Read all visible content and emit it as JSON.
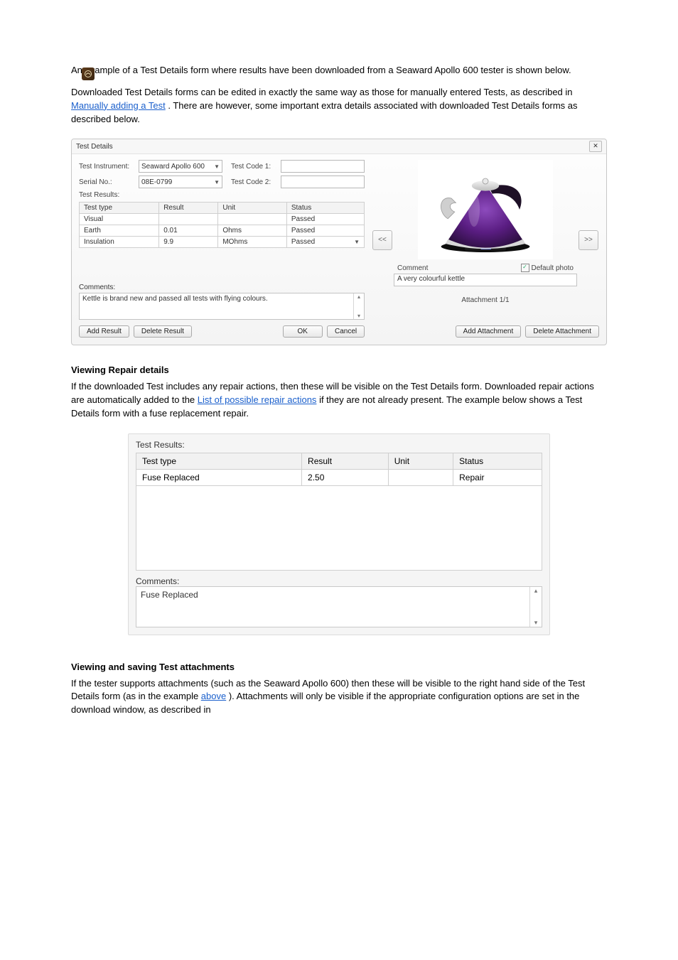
{
  "doc": {
    "paragraphs": {
      "p1": "An example of a Test Details form where results have been downloaded from a Seaward Apollo 600 tester is shown below.",
      "p2_prefix": "Downloaded Test Details forms can be edited in exactly the same way as those for manually entered Tests, as described in ",
      "p2_link": "Manually adding a Test",
      "p2_suffix": ". There are however, some important extra details associated with downloaded Test Details forms as described below.",
      "repairs_title": "Viewing Repair details",
      "repairs_p_prefix": "If the downloaded Test includes any repair actions, then these will be visible on the Test Details form. Downloaded repair actions are automatically added to the ",
      "repairs_link": "List of possible repair actions",
      "repairs_p_suffix": " if they are not already present. The example below shows a Test Details form with a fuse replacement repair.",
      "attach_title": "Viewing and saving Test attachments",
      "attach_p_prefix": "If the tester supports attachments (such as the Seaward Apollo 600) then these will be visible to the right hand side of the Test Details form (as in the example ",
      "attach_link_above": "above",
      "attach_p_suffix": "). Attachments will only be visible if the appropriate configuration options are set in the download window, as described in "
    }
  },
  "dialog": {
    "title": "Test Details",
    "labels": {
      "instrument": "Test Instrument:",
      "serial": "Serial No.:",
      "results": "Test Results:",
      "tc1": "Test Code 1:",
      "tc2": "Test Code 2:",
      "comments": "Comments:",
      "comment_r": "Comment",
      "default_photo": "Default photo",
      "att_count": "Attachment 1/1"
    },
    "values": {
      "instrument": "Seaward Apollo 600",
      "serial": "08E-0799",
      "tc1": "",
      "tc2": "",
      "comments": "Kettle is brand new and passed all tests with flying colours.",
      "att_comment": "A very colourful kettle"
    },
    "table": {
      "headers": [
        "Test type",
        "Result",
        "Unit",
        "Status"
      ],
      "rows": [
        {
          "type": "Visual",
          "result": "",
          "unit": "",
          "status": "Passed",
          "dropdown": false
        },
        {
          "type": "Earth",
          "result": "0.01",
          "unit": "Ohms",
          "status": "Passed",
          "dropdown": false
        },
        {
          "type": "Insulation",
          "result": "9.9",
          "unit": "MOhms",
          "status": "Passed",
          "dropdown": true
        }
      ]
    },
    "buttons": {
      "add_result": "Add Result",
      "delete_result": "Delete Result",
      "ok": "OK",
      "cancel": "Cancel",
      "add_attachment": "Add Attachment",
      "delete_attachment": "Delete Attachment",
      "prev": "<<",
      "next": ">>"
    }
  },
  "results2": {
    "title": "Test Results:",
    "headers": [
      "Test type",
      "Result",
      "Unit",
      "Status"
    ],
    "row": {
      "type": "Fuse Replaced",
      "result": "2.50",
      "unit": "",
      "status": "Repair"
    },
    "comments_label": "Comments:",
    "comments_value": "Fuse Replaced"
  }
}
